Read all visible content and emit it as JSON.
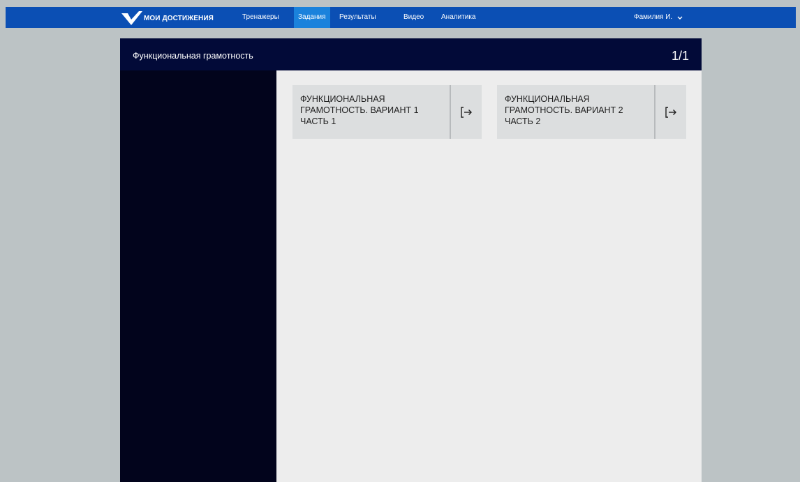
{
  "header": {
    "logo_text": "МОИ ДОСТИЖЕНИЯ",
    "nav": [
      {
        "label": "Тренажеры",
        "active": false
      },
      {
        "label": "Задания",
        "active": true
      },
      {
        "label": "Результаты",
        "active": false
      },
      {
        "label": "Видео",
        "active": false
      },
      {
        "label": "Аналитика",
        "active": false
      }
    ],
    "user_name": "Фамилия И.",
    "user_menu_icon": "chevron-down-icon"
  },
  "panel": {
    "title": "Функциональная грамотность",
    "page_counter": "1/1"
  },
  "cards": [
    {
      "lines": [
        "ФУНКЦИОНАЛЬНАЯ",
        "ГРАМОТНОСТЬ. ВАРИАНТ 1",
        "ЧАСТЬ 1"
      ],
      "action_icon": "enter-icon"
    },
    {
      "lines": [
        "ФУНКЦИОНАЛЬНАЯ",
        "ГРАМОТНОСТЬ. ВАРИАНТ 2",
        "ЧАСТЬ 2"
      ],
      "action_icon": "enter-icon"
    }
  ],
  "colors": {
    "topbar": "#0b4fb4",
    "active_tab": "#1a82dc",
    "panel_header": "#020a38",
    "sidebar": "#02041c",
    "content": "#ededed",
    "card": "#dcdedf",
    "page_bg": "#bcc3c5"
  }
}
